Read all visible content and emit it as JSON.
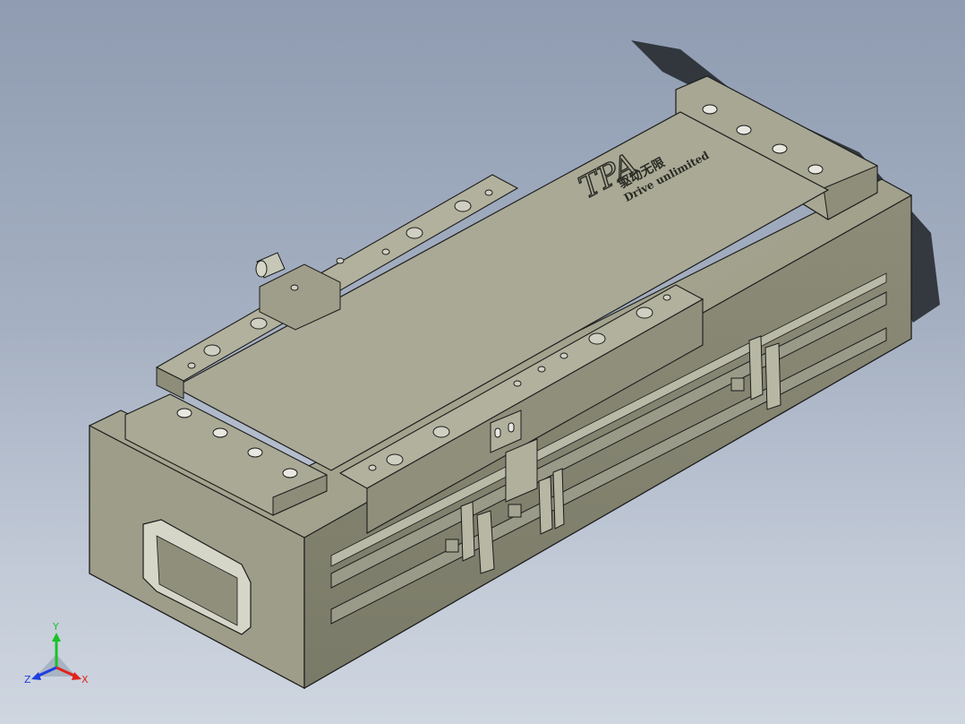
{
  "viewport": {
    "background_top": "#8f9cb1",
    "background_bottom": "#cfd6e0"
  },
  "model": {
    "brand_logo_text": "TPA",
    "brand_chinese": "驱动无限",
    "brand_english": "Drive unlimited",
    "body_color": "#b4b4a2",
    "edge_color": "#1c1c1c"
  },
  "triad": {
    "x_label": "X",
    "y_label": "Y",
    "z_label": "Z",
    "x_color": "#e2231a",
    "y_color": "#19c22a",
    "z_color": "#1f3fe0"
  }
}
